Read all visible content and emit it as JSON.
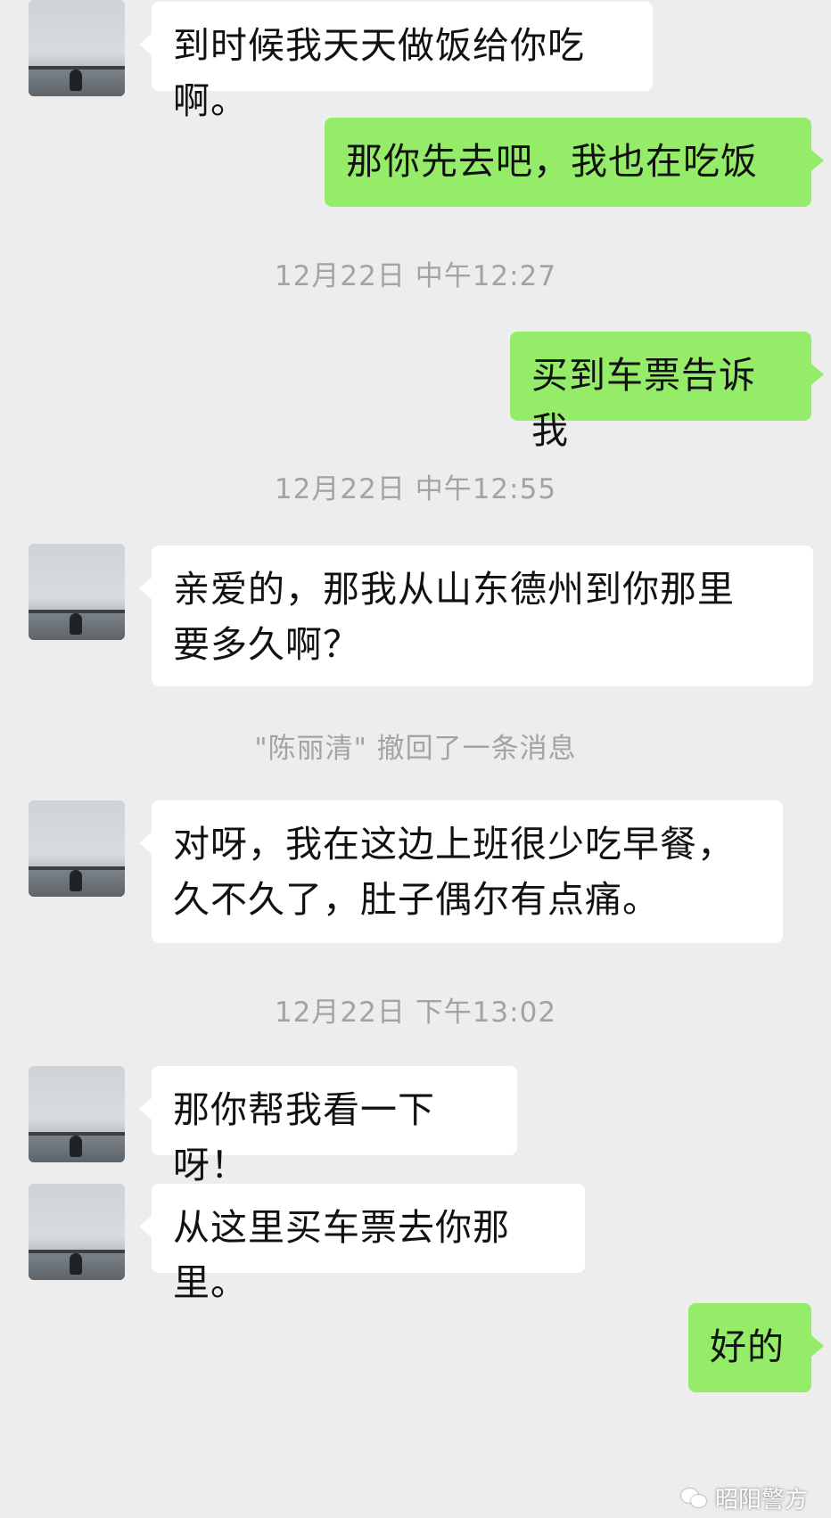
{
  "messages": [
    {
      "side": "in",
      "text": "到时候我天天做饭给你吃啊。"
    },
    {
      "side": "out",
      "text": "那你先去吧，我也在吃饭"
    },
    {
      "side": "time",
      "text": "12月22日 中午12:27"
    },
    {
      "side": "out",
      "text": "买到车票告诉我"
    },
    {
      "side": "time",
      "text": "12月22日 中午12:55"
    },
    {
      "side": "in",
      "line1": "亲爱的，那我从山东德州到你那里",
      "line2": "要多久啊？"
    },
    {
      "side": "notice",
      "text": "\"陈丽清\" 撤回了一条消息"
    },
    {
      "side": "in",
      "line1": "对呀，我在这边上班很少吃早餐，",
      "line2": "久不久了，肚子偶尔有点痛。"
    },
    {
      "side": "time",
      "text": "12月22日 下午13:02"
    },
    {
      "side": "in",
      "text": "那你帮我看一下呀！"
    },
    {
      "side": "in",
      "text": "从这里买车票去你那里。"
    },
    {
      "side": "out",
      "text": "好的"
    }
  ],
  "watermark": {
    "text": "昭阳警方",
    "icon": "wechat-icon"
  },
  "colors": {
    "background": "#ededed",
    "incoming_bubble": "#ffffff",
    "outgoing_bubble": "#95ec69",
    "system_text": "#a3a3a3"
  }
}
